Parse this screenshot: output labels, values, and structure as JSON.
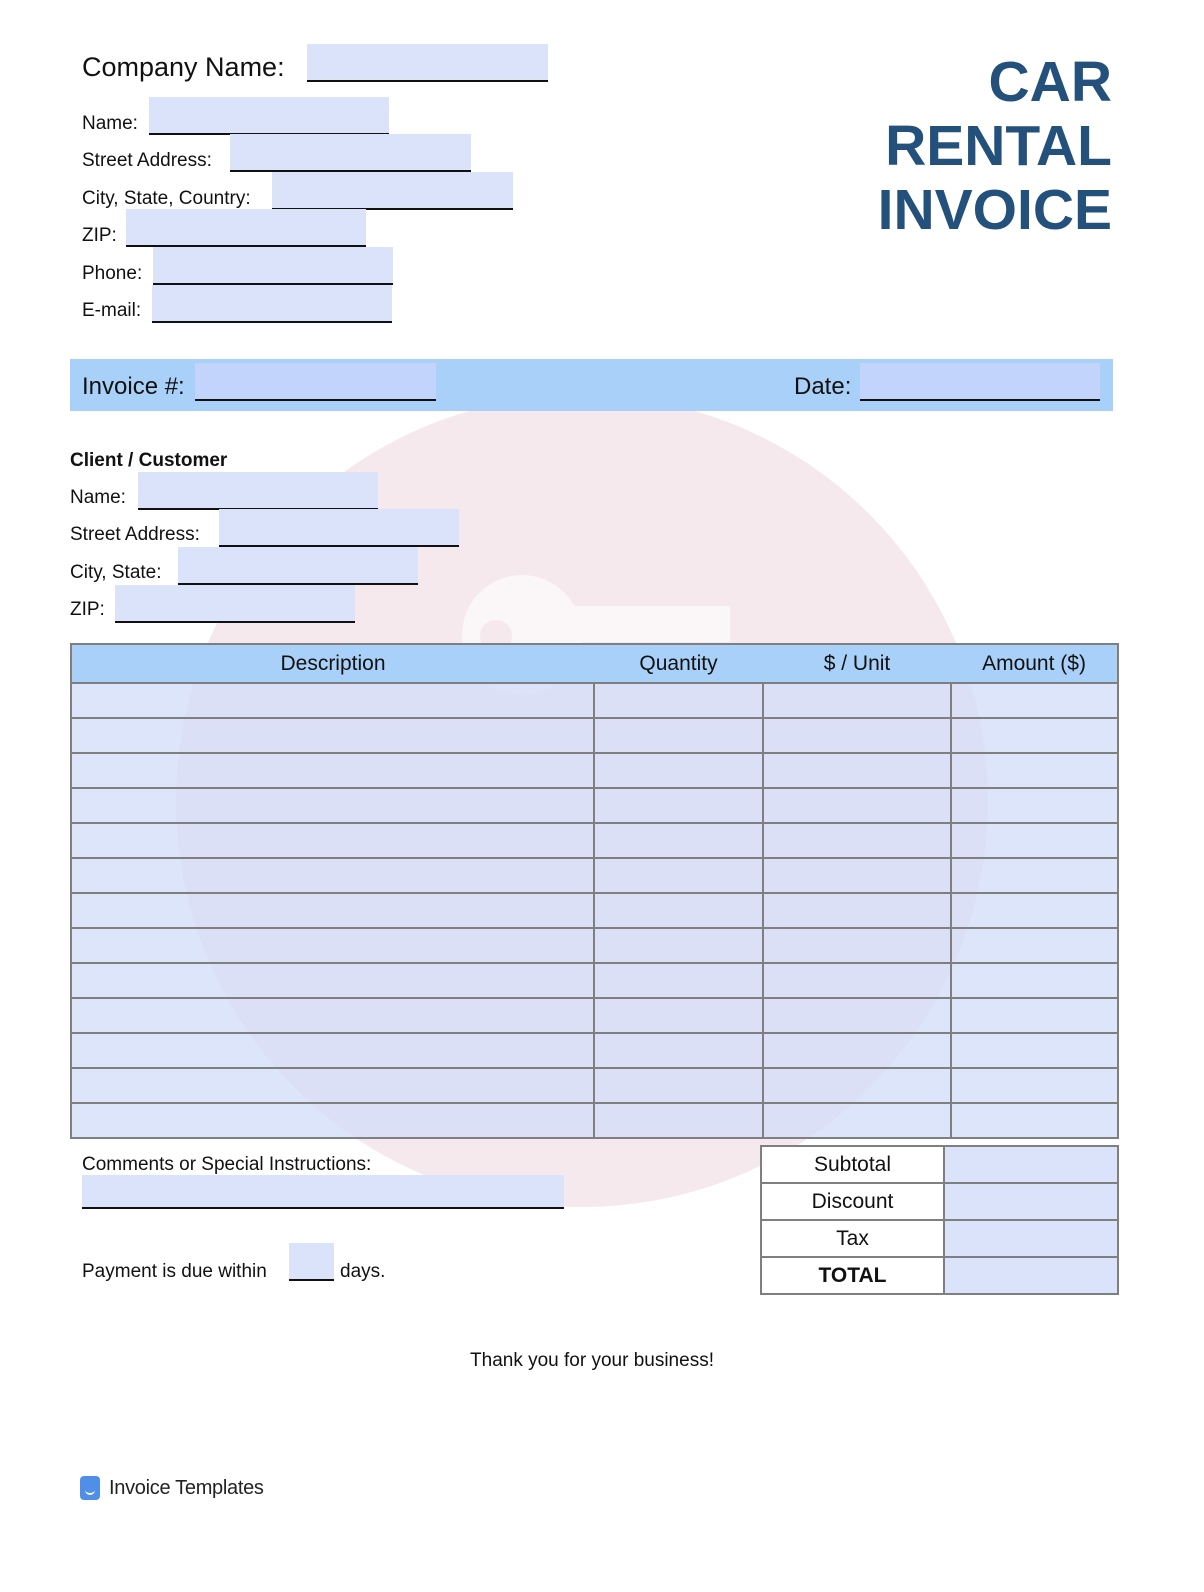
{
  "header": {
    "title_lines": [
      "CAR",
      "RENTAL",
      "INVOICE"
    ],
    "company_name_label": "Company Name:",
    "sender_fields": [
      {
        "label": "Name:",
        "value": ""
      },
      {
        "label": "Street Address:",
        "value": ""
      },
      {
        "label": "City, State, Country:",
        "value": ""
      },
      {
        "label": "ZIP:",
        "value": ""
      },
      {
        "label": "Phone:",
        "value": ""
      },
      {
        "label": "E-mail:",
        "value": ""
      }
    ]
  },
  "invoice_bar": {
    "invoice_label": "Invoice #:",
    "invoice_value": "",
    "date_label": "Date:",
    "date_value": ""
  },
  "client": {
    "heading": "Client / Customer",
    "fields": [
      {
        "label": "Name:",
        "value": ""
      },
      {
        "label": "Street Address:",
        "value": ""
      },
      {
        "label": "City, State:",
        "value": ""
      },
      {
        "label": "ZIP:",
        "value": ""
      }
    ]
  },
  "items_table": {
    "columns": [
      "Description",
      "Quantity",
      "$ / Unit",
      "Amount ($)"
    ],
    "row_count": 13
  },
  "comments": {
    "label": "Comments or Special Instructions:",
    "value": ""
  },
  "payment": {
    "prefix": "Payment is due within",
    "days_value": "",
    "suffix": "days."
  },
  "totals": [
    {
      "label": "Subtotal",
      "value": ""
    },
    {
      "label": "Discount",
      "value": ""
    },
    {
      "label": "Tax",
      "value": ""
    },
    {
      "label": "TOTAL",
      "value": ""
    }
  ],
  "footer": {
    "thank_you": "Thank you for your business!",
    "brand": "Invoice Templates"
  },
  "colors": {
    "title": "#24517c",
    "bar": "#a8d0f8",
    "field": "#dbe3fb"
  }
}
